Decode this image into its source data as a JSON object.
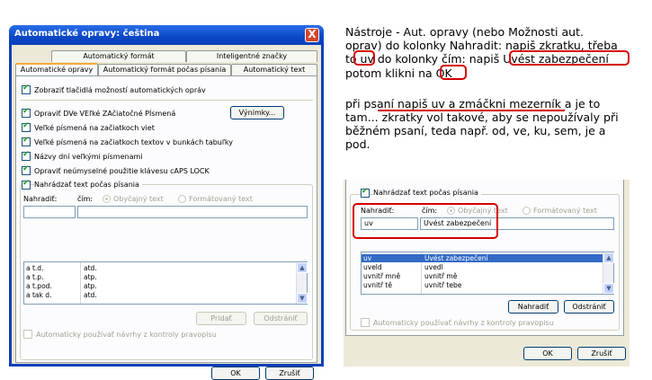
{
  "dialog": {
    "title": "Automatické opravy: čeština",
    "close": "X",
    "tabs_top": [
      "Automatický formát",
      "Inteligentné značky"
    ],
    "tabs_bottom": [
      "Automatické opravy",
      "Automatický formát počas písania",
      "Automatický text"
    ],
    "show_buttons": "Zobraziť tlačidlá možností automatických opráv",
    "options": [
      "Opraviť DVe VEľké ZAčiatočné PÍsmená",
      "Veľké písmená na začiatkoch viet",
      "Veľké písmená na začiatkoch textov v bunkách tabuľky",
      "Názvy dní veľkými písmenami",
      "Opraviť neúmyselné použitie klávesu cAPS LOCK"
    ],
    "exceptions_button": "Výnimky...",
    "replace_while_typing": "Nahrádzať text počas písania",
    "replace_label": "Nahradiť:",
    "with_label": "čím:",
    "plain_text": "Obyčajný text",
    "formatted_text": "Formátovaný text",
    "replace_value": "",
    "with_value": "",
    "rows": [
      [
        "a t.d.",
        "atd."
      ],
      [
        "a t.p.",
        "atp."
      ],
      [
        "a t.pod.",
        "atp."
      ],
      [
        "a tak d.",
        "atd."
      ]
    ],
    "add_button": "Pridať",
    "delete_button": "Odstrániť",
    "auto_suggest": "Automaticky používať návrhy z kontroly pravopisu",
    "ok_button": "OK",
    "cancel_button": "Zrušiť"
  },
  "instructions": {
    "line1": "Nástroje - Aut. opravy (nebo  Možnosti aut.",
    "line2": "oprav) do kolonky Nahradit:  napiš zkratku, třeba",
    "line3a": "to ",
    "line3_uv": "uv",
    "line3b": " do kolonky čím: napiš ",
    "line3_phrase": "Uvést zabezpečení",
    "line4a": "potom  klikni na ",
    "line4_ok": "OK",
    "para2_line1": "při psaní napiš uv a zmáčkni mezerník a je to",
    "para2_line2": "tam... zkratky vol takové, aby se nepoužívaly při",
    "para2_line3": "běžném psaní, teda např. od, ve, ku, sem, je a",
    "para2_line4": "pod."
  },
  "crop": {
    "replace_while_typing": "Nahrádzať text počas písania",
    "replace_label": "Nahradiť:",
    "with_label": "čím:",
    "plain_text": "Obyčajný text",
    "formatted_text": "Formátovaný text",
    "replace_value": "uv",
    "with_value": "Uvést zabezpečení",
    "rows": [
      [
        "uv",
        "Uvést zabezpečení"
      ],
      [
        "uveld",
        "uvedl"
      ],
      [
        "uvnitř mně",
        "uvnitř mě"
      ],
      [
        "uvnitř tě",
        "uvnitř tebe"
      ]
    ],
    "replace_button": "Nahradiť",
    "delete_button": "Odstrániť",
    "auto_suggest": "Automaticky používať návrhy z kontroly pravopisu",
    "ok_button": "OK",
    "cancel_button": "Zrušiť"
  }
}
